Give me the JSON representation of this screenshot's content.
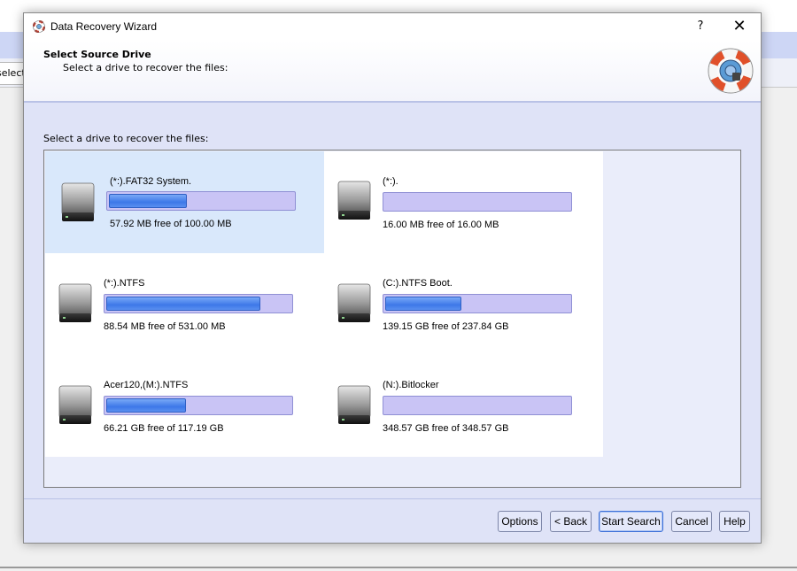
{
  "background": {
    "tab_label": "select"
  },
  "window": {
    "title": "Data Recovery Wizard",
    "help_label": "?",
    "close_label": "✕"
  },
  "header": {
    "title": "Select Source Drive",
    "subtitle": "Select a drive to recover the files:"
  },
  "body": {
    "label": "Select a drive to recover the files:"
  },
  "drives": [
    {
      "name": "(*:).FAT32 System.",
      "free": "57.92 MB free of 100.00 MB",
      "used_fraction": 0.42,
      "selected": true
    },
    {
      "name": "(*:).",
      "free": "16.00 MB free of 16.00 MB",
      "used_fraction": 0.0,
      "selected": false
    },
    {
      "name": "(*:).NTFS",
      "free": "88.54 MB free of 531.00 MB",
      "used_fraction": 0.83,
      "selected": false
    },
    {
      "name": "(C:).NTFS Boot.",
      "free": "139.15 GB free of 237.84 GB",
      "used_fraction": 0.41,
      "selected": false
    },
    {
      "name": "Acer120,(M:).NTFS",
      "free": "66.21 GB free of 117.19 GB",
      "used_fraction": 0.43,
      "selected": false
    },
    {
      "name": "(N:).Bitlocker",
      "free": "348.57 GB free of 348.57 GB",
      "used_fraction": 0.0,
      "selected": false
    }
  ],
  "buttons": {
    "options": "Options",
    "back": "< Back",
    "start_search": "Start Search",
    "cancel": "Cancel",
    "help": "Help"
  },
  "colors": {
    "bar_fill": "#3d78e8",
    "bar_track": "#c9c4f5",
    "selected_bg": "#d9e8fb"
  }
}
